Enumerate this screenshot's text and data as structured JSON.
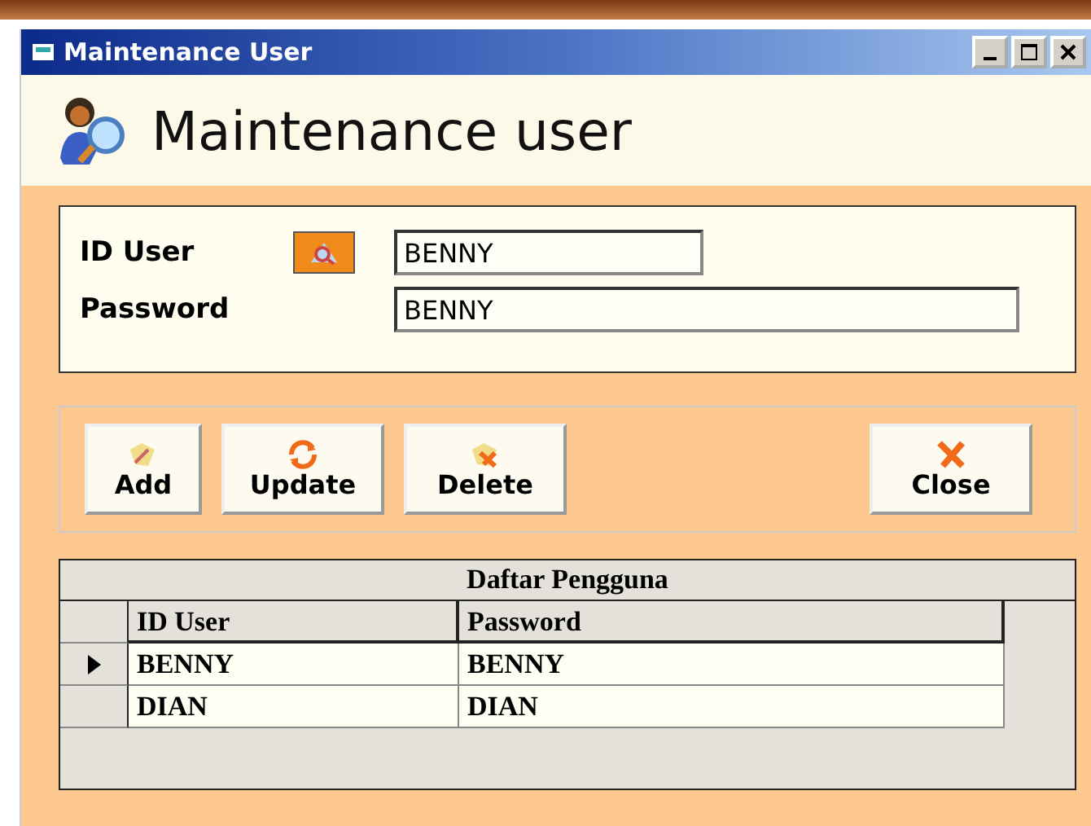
{
  "window": {
    "title": "Maintenance User"
  },
  "header": {
    "title": "Maintenance user"
  },
  "form": {
    "fields": [
      {
        "label": "ID User",
        "value": "BENNY",
        "kind": "lookup"
      },
      {
        "label": "Password",
        "value": "BENNY",
        "kind": "text"
      }
    ]
  },
  "buttons": [
    {
      "label": "Add",
      "kind": "add"
    },
    {
      "label": "Update",
      "kind": "update"
    },
    {
      "label": "Delete",
      "kind": "delete"
    },
    {
      "label": "Close",
      "kind": "close"
    }
  ],
  "grid": {
    "caption": "Daftar Pengguna",
    "columns": [
      "ID User",
      "Password"
    ],
    "rows": [
      {
        "cells": [
          "BENNY",
          "BENNY"
        ],
        "selected": true
      },
      {
        "cells": [
          "DIAN",
          "DIAN"
        ],
        "selected": false
      }
    ]
  }
}
